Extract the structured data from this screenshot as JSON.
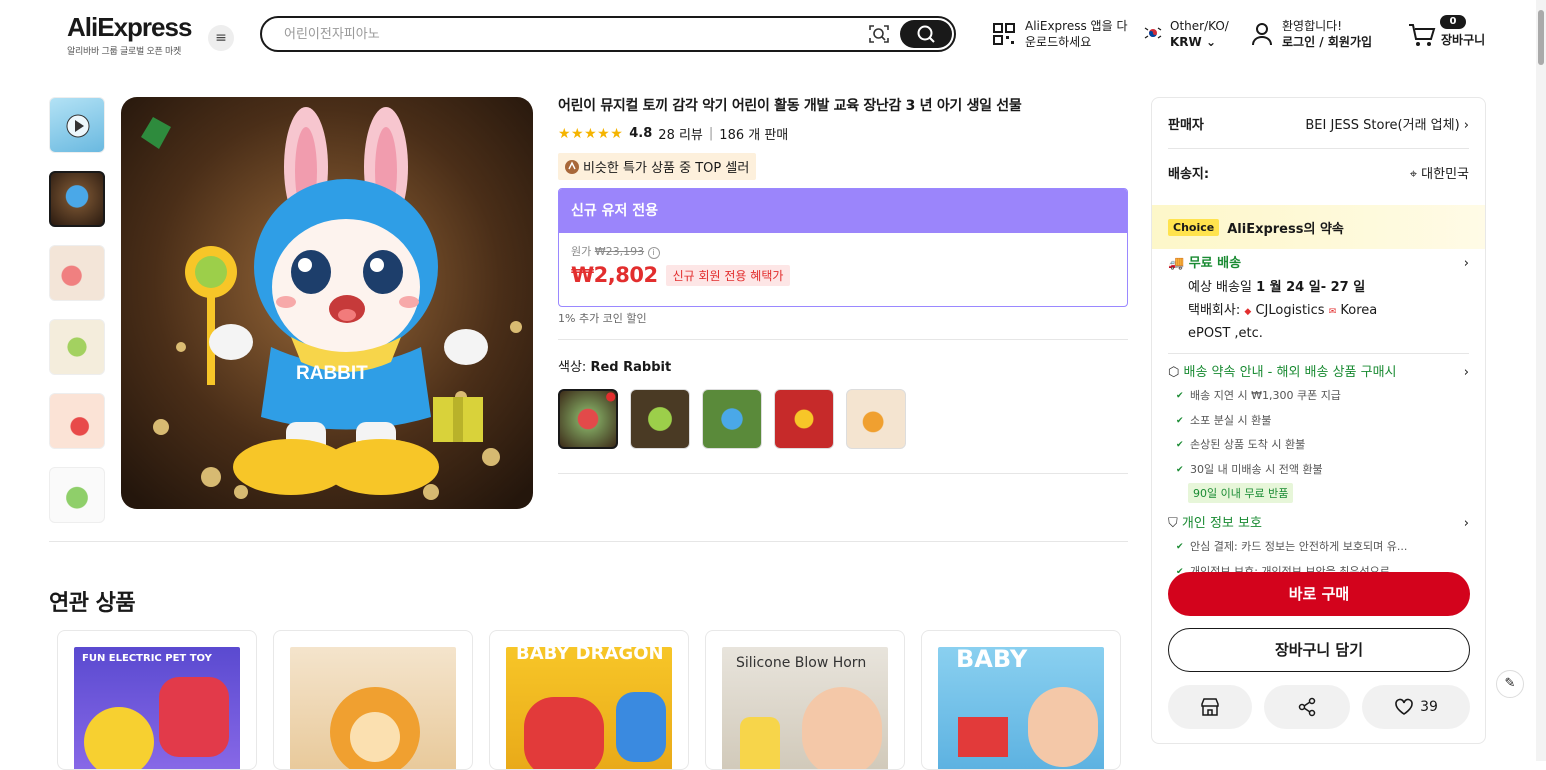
{
  "header": {
    "logo": "AliExpress",
    "logo_sub": "알리바바 그룹 글로벌 오픈 마켓",
    "search_placeholder": "어린이전자피아노",
    "app_line1": "AliExpress 앱을 다",
    "app_line2": "운로드하세요",
    "region_line1": "Other/KO/",
    "region_line2": "KRW",
    "welcome": "환영합니다!",
    "login": "로그인 / 회원가입",
    "cart_count": "0",
    "cart_label": "장바구니"
  },
  "product": {
    "title": "어린이 뮤지컬 토끼 감각 악기 어린이 활동 개발 교육 장난감 3 년 아기 생일 선물",
    "stars": "★★★★★",
    "rating": "4.8",
    "reviews": "28 리뷰",
    "sold": "186 개 판매",
    "top_seller": "비슷한 특가 상품 중 TOP 셀러",
    "price_header": "신규 유저 전용",
    "orig_label": "원가",
    "orig_price": "₩23,193",
    "price": "₩2,802",
    "price_badge": "신규 회원 전용 혜택가",
    "coin": "1% 추가 코인 할인",
    "color_label": "색상:",
    "color_value": "Red Rabbit"
  },
  "related": {
    "title": "연관 상품",
    "cards": [
      "FUN ELECTRIC PET TOY",
      "",
      "BABY DRAGON",
      "Silicone Blow Horn",
      "BABY"
    ]
  },
  "panel": {
    "seller_label": "판매자",
    "seller_name": "BEI JESS Store(거래 업체)",
    "ship_label": "배송지:",
    "ship_to": "대한민국",
    "choice_badge": "Choice",
    "choice_title": "AliExpress의 약속",
    "free_ship": "무료 배송",
    "eta_label": "예상 배송일",
    "eta": "1 월 24 일- 27 일",
    "courier_label": "택배회사:",
    "courier_a": "CJLogistics",
    "courier_b": "Korea",
    "courier_c": "ePOST ,etc.",
    "promise_title": "배송 약속 안내 - 해외 배송 상품 구매시",
    "promise_items": [
      "배송 지연 시 ₩1,300 쿠폰 지급",
      "소포 분실 시 환불",
      "손상된 상품 도착 시 환불",
      "30일 내 미배송 시 전액 환불"
    ],
    "return_badge": "90일 이내 무료 반품",
    "privacy_title": "개인 정보 보호",
    "privacy_items": [
      "안심 결제: 카드 정보는 안전하게 보호되며 유...",
      "개인정보 보호: 개인정보 보안을 최우선으로..."
    ],
    "buy_now": "바로 구매",
    "add_cart": "장바구니 담기",
    "wish_count": "39"
  }
}
